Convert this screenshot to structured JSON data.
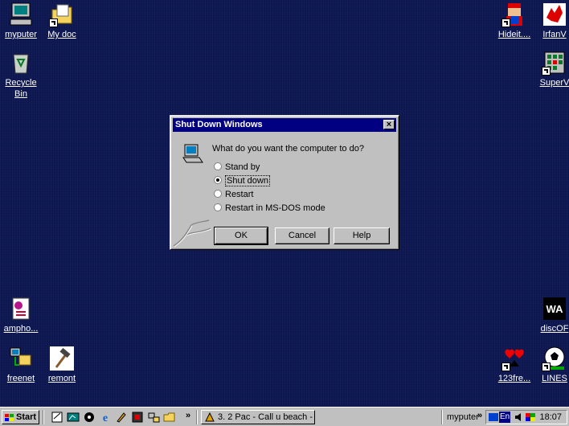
{
  "desktop": {
    "icons": {
      "myputer": "myputer",
      "mydoc": "My doc",
      "recycle": "Recycle Bin",
      "hideit": "Hideit....",
      "irfanview": "IrfanV",
      "superv": "SuperV",
      "ampho": "ampho...",
      "freenet": "freenet",
      "remont": "remont",
      "discof": "discOF",
      "freegames": "123fre...",
      "lines": "LINES"
    }
  },
  "dialog": {
    "title": "Shut Down Windows",
    "question": "What do you want the computer to do?",
    "options": [
      "Stand by",
      "Shut down",
      "Restart",
      "Restart in MS-DOS mode"
    ],
    "selected": "Shut down",
    "ok": "OK",
    "cancel": "Cancel",
    "help": "Help"
  },
  "taskbar": {
    "start": "Start",
    "chevron": "»",
    "task": "3. 2 Pac - Call u beach - ...",
    "toolbar_label": "myputer",
    "lang": "En",
    "time": "18:07"
  }
}
